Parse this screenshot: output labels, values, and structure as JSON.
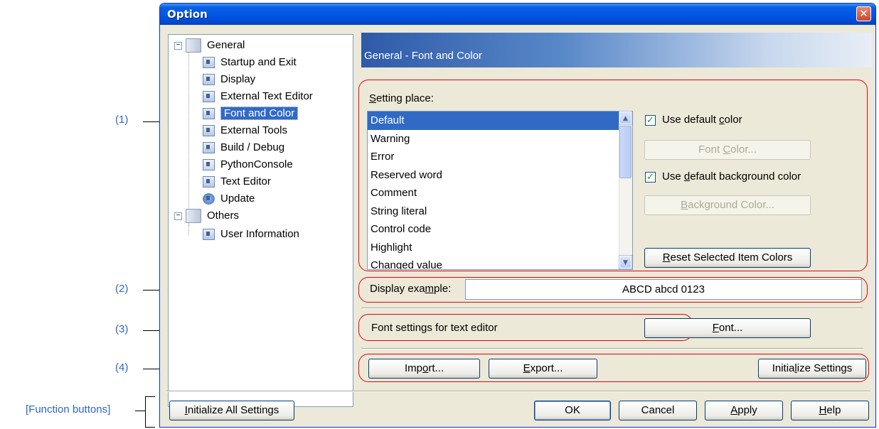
{
  "callouts": {
    "c1": "(1)",
    "c2": "(2)",
    "c3": "(3)",
    "c4": "(4)",
    "function_buttons": "[Function buttons]"
  },
  "window": {
    "title": "Option",
    "close_symbol": "✕"
  },
  "tree": {
    "general": "General",
    "items_general": [
      "Startup and Exit",
      "Display",
      "External Text Editor",
      "Font and Color",
      "External Tools",
      "Build / Debug",
      "PythonConsole",
      "Text Editor",
      "Update"
    ],
    "others": "Others",
    "items_others": [
      "User Information"
    ],
    "expander_symbol": "−"
  },
  "header": {
    "text": "General - Font and Color"
  },
  "setting_place": {
    "label_prefix": "S",
    "label_rest": "etting place:",
    "items": [
      "Default",
      "Warning",
      "Error",
      "Reserved word",
      "Comment",
      "String literal",
      "Control code",
      "Highlight",
      "Changed value"
    ],
    "selected": "Default"
  },
  "colors_panel": {
    "use_default_color_pre": "Use default ",
    "use_default_color_ul": "c",
    "use_default_color_post": "olor",
    "use_default_color_checked": true,
    "font_color_pre": "Font ",
    "font_color_ul": "C",
    "font_color_post": "olor...",
    "use_default_bg_pre": "Use ",
    "use_default_bg_ul": "d",
    "use_default_bg_post": "efault background color",
    "use_default_bg_checked": true,
    "bg_color_ul": "B",
    "bg_color_post": "ackground Color...",
    "reset_ul": "R",
    "reset_post": "eset Selected Item Colors",
    "check_symbol": "✓"
  },
  "display_example": {
    "label_pre": "Display exa",
    "label_ul": "m",
    "label_post": "ple:",
    "value": "ABCD abcd 0123"
  },
  "font_settings": {
    "label": "Font settings for text editor",
    "button_ul": "F",
    "button_post": "ont..."
  },
  "io_buttons": {
    "import_pre": "Imp",
    "import_ul": "o",
    "import_post": "rt...",
    "export_ul": "E",
    "export_post": "xport...",
    "init_pre": "Initia",
    "init_ul": "l",
    "init_post": "ize Settings"
  },
  "footer": {
    "init_all_ul": "I",
    "init_all_post": "nitialize All Settings",
    "ok": "OK",
    "cancel": "Cancel",
    "apply_ul": "A",
    "apply_post": "pply",
    "help_ul": "H",
    "help_post": "elp"
  },
  "colors": {
    "callout_blue": "#2f67c4",
    "annotation_red": "#e60012",
    "selection_blue": "#316ac5",
    "window_face": "#ece9d8"
  }
}
